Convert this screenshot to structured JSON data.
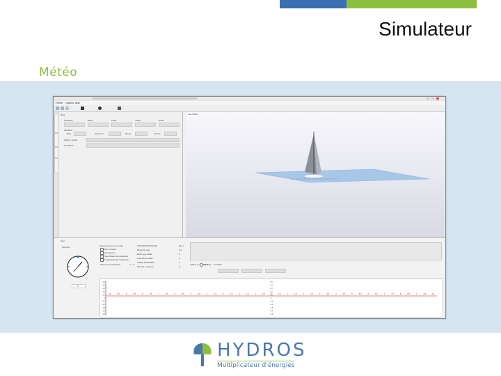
{
  "slide": {
    "title": "Simulateur",
    "section": "Météo",
    "accent_blue": "#3a6fb0",
    "accent_green": "#8cbf3f"
  },
  "app": {
    "menu": [
      "Fichier",
      "Options",
      "Aide"
    ],
    "left_panel": {
      "section_label": "Bras",
      "col_headers": [
        "Tidewave",
        "Wave",
        "TWD",
        "m/Ref",
        "WPD"
      ],
      "row2_label": "ACCELS",
      "row2_fields": [
        "Bras",
        "vitesse Ar",
        "Pivots",
        "Dérive"
      ],
      "row3_label": "Safran, spoiler",
      "row4_label": "Emetteurs"
    },
    "viewport": {
      "label": "Vue Voilier"
    },
    "bottom": {
      "section_label": "Vent",
      "sub_label": "Direction",
      "options": [
        "Type de serveur de mode",
        "Vent constant",
        "Vent régulier",
        "Type Rafale Vent aléatoire",
        "Ponderation De l'Incidence"
      ],
      "value_label": "Valeur de ponderation",
      "value": "1",
      "value_unit": "m",
      "params": [
        "VITESSE MOYENNE",
        "Moyenne vag",
        "Ecart type rafale",
        "Fréquence rafale",
        "FREQ. FISSURES",
        "Période moyenne"
      ],
      "param_values": [
        "15 m",
        "2 m",
        "0",
        "0",
        "0",
        "0"
      ],
      "radio_label": "Utiliser le dirigeable",
      "radio_options": [
        "Aléatoire",
        "Constant"
      ],
      "stepper_value": "0"
    },
    "plot": {
      "line_color": "#e05050",
      "x_ticks": [
        "-10",
        "-9.5",
        "-9",
        "-8.5",
        "-8",
        "-7.5",
        "-7",
        "-6.5",
        "-6",
        "-5.5",
        "-5",
        "-4.5",
        "-4",
        "-3.5",
        "-3",
        "-2.5",
        "-2",
        "-1.5",
        "-1",
        "-0.5",
        "0",
        "0.5",
        "1",
        "1.5",
        "2",
        "2.5",
        "3",
        "3.5",
        "4",
        "4.5",
        "5",
        "5.5",
        "6",
        "6.5",
        "7",
        "7.5",
        "8",
        "8.5",
        "9",
        "9.5",
        "10"
      ],
      "y_ticks": [
        "0.5",
        "0.4",
        "0.3",
        "0.2",
        "0.1",
        "0",
        "-0.1",
        "-0.2",
        "-0.3",
        "-0.4",
        "-0.5"
      ]
    }
  },
  "logo": {
    "brand": "HYDROS",
    "tagline": "Multiplicateur d'énergies",
    "color_blue": "#4a78a8",
    "color_green": "#8cbf3f"
  }
}
